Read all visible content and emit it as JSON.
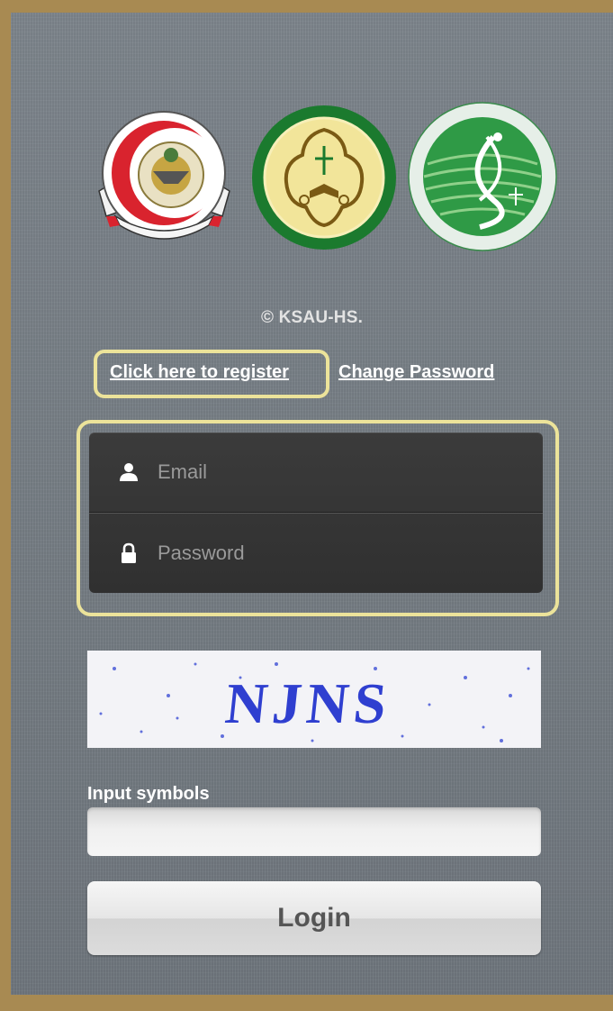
{
  "footer": {
    "copyright": "© KSAU-HS."
  },
  "links": {
    "register": "Click here to register",
    "change_password": "Change Password"
  },
  "login_form": {
    "email_placeholder": "Email",
    "password_placeholder": "Password",
    "captcha_text": "NJNS",
    "symbols_label": "Input symbols",
    "symbols_value": "",
    "login_label": "Login"
  },
  "icons": {
    "email": "user-icon",
    "password": "lock-icon"
  },
  "colors": {
    "highlight_border": "#ece39a",
    "panel": "#747b82",
    "frame": "#a88a52"
  }
}
